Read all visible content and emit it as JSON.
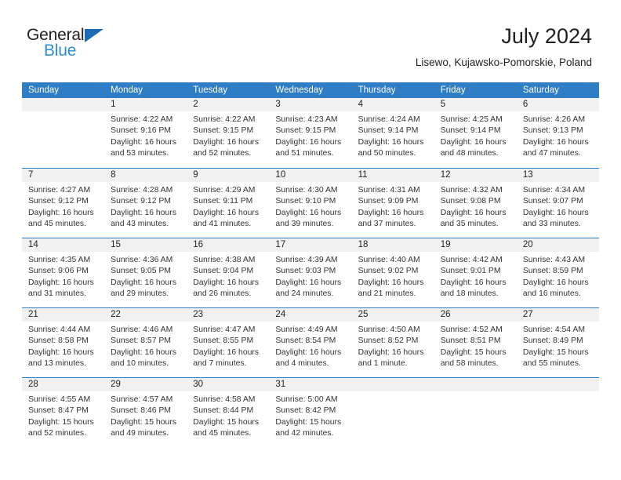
{
  "logo": {
    "word_top": "General",
    "word_bottom": "Blue",
    "triangle_color": "#1c6cb5",
    "blue_color": "#2a8fd4"
  },
  "header": {
    "title": "July 2024",
    "subtitle": "Lisewo, Kujawsko-Pomorskie, Poland"
  },
  "theme": {
    "header_blue": "#2f7dc4",
    "daynum_band": "#f1f1f1",
    "text": "#231f20"
  },
  "calendar": {
    "day_headers": [
      "Sunday",
      "Monday",
      "Tuesday",
      "Wednesday",
      "Thursday",
      "Friday",
      "Saturday"
    ],
    "weeks": [
      [
        {
          "day": "",
          "lines": []
        },
        {
          "day": "1",
          "lines": [
            "Sunrise: 4:22 AM",
            "Sunset: 9:16 PM",
            "Daylight: 16 hours",
            "and 53 minutes."
          ]
        },
        {
          "day": "2",
          "lines": [
            "Sunrise: 4:22 AM",
            "Sunset: 9:15 PM",
            "Daylight: 16 hours",
            "and 52 minutes."
          ]
        },
        {
          "day": "3",
          "lines": [
            "Sunrise: 4:23 AM",
            "Sunset: 9:15 PM",
            "Daylight: 16 hours",
            "and 51 minutes."
          ]
        },
        {
          "day": "4",
          "lines": [
            "Sunrise: 4:24 AM",
            "Sunset: 9:14 PM",
            "Daylight: 16 hours",
            "and 50 minutes."
          ]
        },
        {
          "day": "5",
          "lines": [
            "Sunrise: 4:25 AM",
            "Sunset: 9:14 PM",
            "Daylight: 16 hours",
            "and 48 minutes."
          ]
        },
        {
          "day": "6",
          "lines": [
            "Sunrise: 4:26 AM",
            "Sunset: 9:13 PM",
            "Daylight: 16 hours",
            "and 47 minutes."
          ]
        }
      ],
      [
        {
          "day": "7",
          "lines": [
            "Sunrise: 4:27 AM",
            "Sunset: 9:12 PM",
            "Daylight: 16 hours",
            "and 45 minutes."
          ]
        },
        {
          "day": "8",
          "lines": [
            "Sunrise: 4:28 AM",
            "Sunset: 9:12 PM",
            "Daylight: 16 hours",
            "and 43 minutes."
          ]
        },
        {
          "day": "9",
          "lines": [
            "Sunrise: 4:29 AM",
            "Sunset: 9:11 PM",
            "Daylight: 16 hours",
            "and 41 minutes."
          ]
        },
        {
          "day": "10",
          "lines": [
            "Sunrise: 4:30 AM",
            "Sunset: 9:10 PM",
            "Daylight: 16 hours",
            "and 39 minutes."
          ]
        },
        {
          "day": "11",
          "lines": [
            "Sunrise: 4:31 AM",
            "Sunset: 9:09 PM",
            "Daylight: 16 hours",
            "and 37 minutes."
          ]
        },
        {
          "day": "12",
          "lines": [
            "Sunrise: 4:32 AM",
            "Sunset: 9:08 PM",
            "Daylight: 16 hours",
            "and 35 minutes."
          ]
        },
        {
          "day": "13",
          "lines": [
            "Sunrise: 4:34 AM",
            "Sunset: 9:07 PM",
            "Daylight: 16 hours",
            "and 33 minutes."
          ]
        }
      ],
      [
        {
          "day": "14",
          "lines": [
            "Sunrise: 4:35 AM",
            "Sunset: 9:06 PM",
            "Daylight: 16 hours",
            "and 31 minutes."
          ]
        },
        {
          "day": "15",
          "lines": [
            "Sunrise: 4:36 AM",
            "Sunset: 9:05 PM",
            "Daylight: 16 hours",
            "and 29 minutes."
          ]
        },
        {
          "day": "16",
          "lines": [
            "Sunrise: 4:38 AM",
            "Sunset: 9:04 PM",
            "Daylight: 16 hours",
            "and 26 minutes."
          ]
        },
        {
          "day": "17",
          "lines": [
            "Sunrise: 4:39 AM",
            "Sunset: 9:03 PM",
            "Daylight: 16 hours",
            "and 24 minutes."
          ]
        },
        {
          "day": "18",
          "lines": [
            "Sunrise: 4:40 AM",
            "Sunset: 9:02 PM",
            "Daylight: 16 hours",
            "and 21 minutes."
          ]
        },
        {
          "day": "19",
          "lines": [
            "Sunrise: 4:42 AM",
            "Sunset: 9:01 PM",
            "Daylight: 16 hours",
            "and 18 minutes."
          ]
        },
        {
          "day": "20",
          "lines": [
            "Sunrise: 4:43 AM",
            "Sunset: 8:59 PM",
            "Daylight: 16 hours",
            "and 16 minutes."
          ]
        }
      ],
      [
        {
          "day": "21",
          "lines": [
            "Sunrise: 4:44 AM",
            "Sunset: 8:58 PM",
            "Daylight: 16 hours",
            "and 13 minutes."
          ]
        },
        {
          "day": "22",
          "lines": [
            "Sunrise: 4:46 AM",
            "Sunset: 8:57 PM",
            "Daylight: 16 hours",
            "and 10 minutes."
          ]
        },
        {
          "day": "23",
          "lines": [
            "Sunrise: 4:47 AM",
            "Sunset: 8:55 PM",
            "Daylight: 16 hours",
            "and 7 minutes."
          ]
        },
        {
          "day": "24",
          "lines": [
            "Sunrise: 4:49 AM",
            "Sunset: 8:54 PM",
            "Daylight: 16 hours",
            "and 4 minutes."
          ]
        },
        {
          "day": "25",
          "lines": [
            "Sunrise: 4:50 AM",
            "Sunset: 8:52 PM",
            "Daylight: 16 hours",
            "and 1 minute."
          ]
        },
        {
          "day": "26",
          "lines": [
            "Sunrise: 4:52 AM",
            "Sunset: 8:51 PM",
            "Daylight: 15 hours",
            "and 58 minutes."
          ]
        },
        {
          "day": "27",
          "lines": [
            "Sunrise: 4:54 AM",
            "Sunset: 8:49 PM",
            "Daylight: 15 hours",
            "and 55 minutes."
          ]
        }
      ],
      [
        {
          "day": "28",
          "lines": [
            "Sunrise: 4:55 AM",
            "Sunset: 8:47 PM",
            "Daylight: 15 hours",
            "and 52 minutes."
          ]
        },
        {
          "day": "29",
          "lines": [
            "Sunrise: 4:57 AM",
            "Sunset: 8:46 PM",
            "Daylight: 15 hours",
            "and 49 minutes."
          ]
        },
        {
          "day": "30",
          "lines": [
            "Sunrise: 4:58 AM",
            "Sunset: 8:44 PM",
            "Daylight: 15 hours",
            "and 45 minutes."
          ]
        },
        {
          "day": "31",
          "lines": [
            "Sunrise: 5:00 AM",
            "Sunset: 8:42 PM",
            "Daylight: 15 hours",
            "and 42 minutes."
          ]
        },
        {
          "day": "",
          "lines": []
        },
        {
          "day": "",
          "lines": []
        },
        {
          "day": "",
          "lines": []
        }
      ]
    ]
  }
}
